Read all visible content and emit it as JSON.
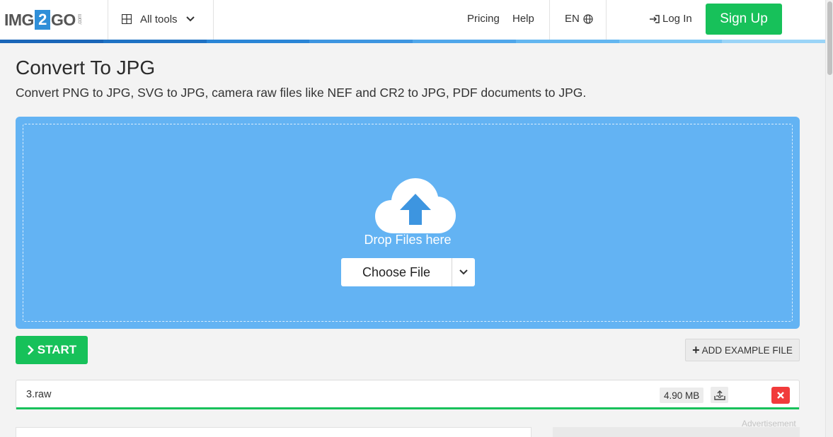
{
  "header": {
    "logo": {
      "part1": "IMG",
      "part2": "2",
      "part3": "GO",
      "suffix": ".com"
    },
    "all_tools_label": "All tools",
    "nav": {
      "pricing": "Pricing",
      "help": "Help"
    },
    "language": "EN",
    "login_label": "Log In",
    "signup_label": "Sign Up",
    "stripe_colors": [
      "#1a66b8",
      "#1f72c4",
      "#2a85d6",
      "#3d95e0",
      "#4fa6ea",
      "#63b6f0",
      "#7cc6f4",
      "#9ad4f7"
    ]
  },
  "page": {
    "title": "Convert To JPG",
    "subtitle": "Convert PNG to JPG, SVG to JPG, camera raw files like NEF and CR2 to JPG, PDF documents to JPG."
  },
  "dropzone": {
    "text": "Drop Files here",
    "choose_label": "Choose File",
    "icon": "cloud-upload-icon"
  },
  "actions": {
    "start_label": "START",
    "add_example_label": "ADD EXAMPLE FILE"
  },
  "files": [
    {
      "name": "3.raw",
      "size": "4.90 MB",
      "upload_progress": 1.0
    }
  ],
  "ad_label": "Advertisement",
  "colors": {
    "accent_green": "#17c15a",
    "dropzone_blue": "#63b3f3",
    "delete_red": "#f13b3b"
  }
}
